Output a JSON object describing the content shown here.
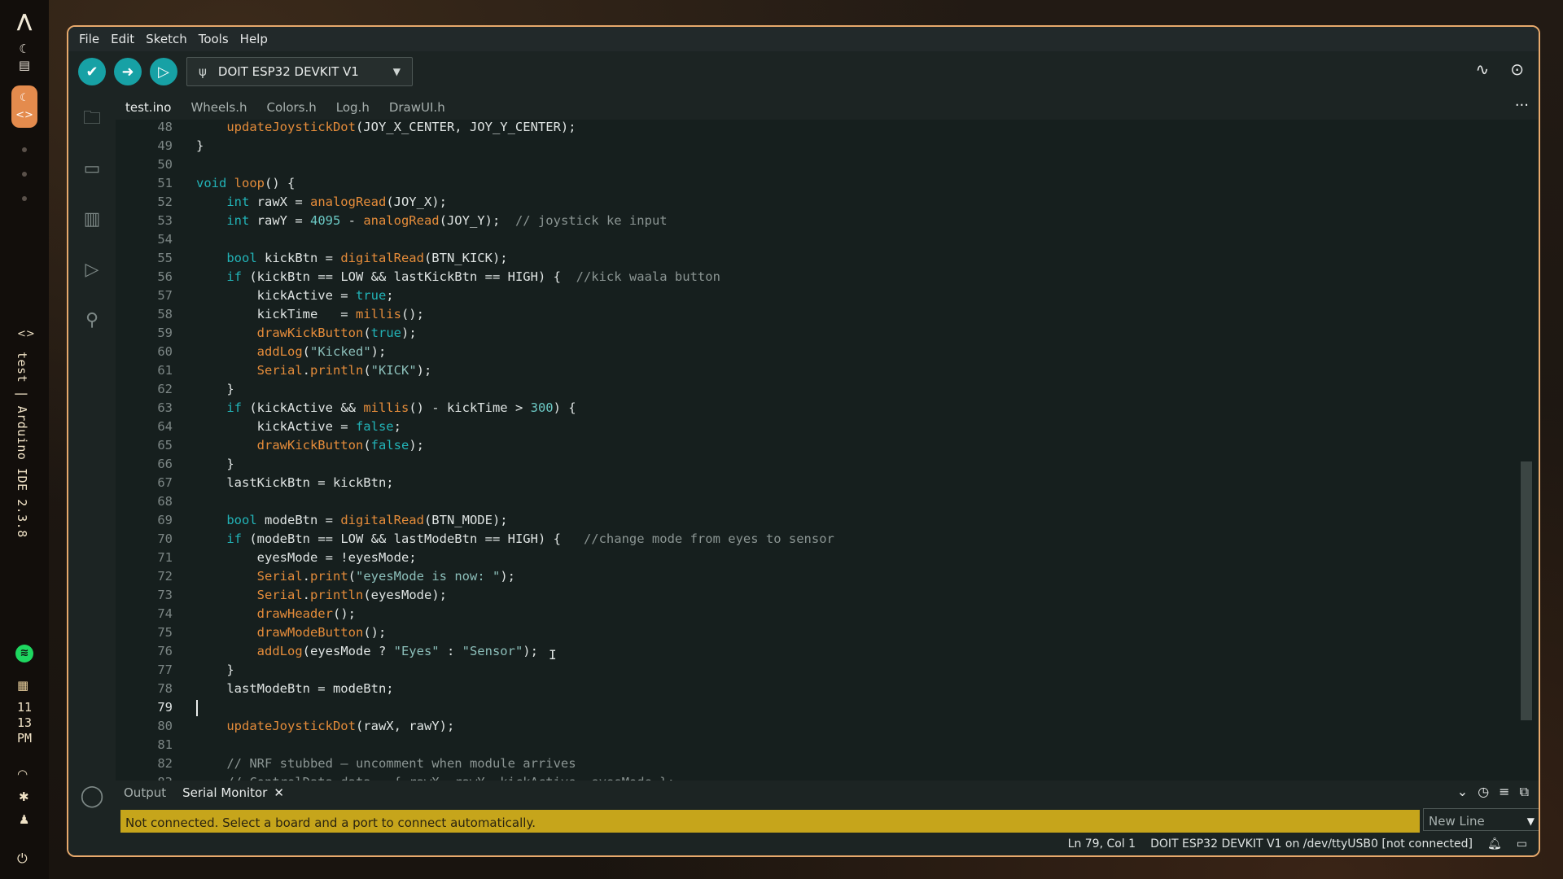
{
  "dock": {
    "window_label": "test | Arduino IDE 2.3.8",
    "clock_hour": "11",
    "clock_minute": "13",
    "clock_ampm": "PM"
  },
  "menu": [
    "File",
    "Edit",
    "Sketch",
    "Tools",
    "Help"
  ],
  "toolbar": {
    "board": "DOIT ESP32 DEVKIT V1"
  },
  "tabs": [
    "test.ino",
    "Wheels.h",
    "Colors.h",
    "Log.h",
    "DrawUI.h"
  ],
  "code_lines": [
    {
      "n": "48",
      "t": [
        [
          "    ",
          "plain"
        ],
        [
          "updateJoystickDot",
          "fn"
        ],
        [
          "(JOY_X_CENTER, JOY_Y_CENTER);",
          "plain"
        ]
      ]
    },
    {
      "n": "49",
      "t": [
        [
          "}",
          "plain"
        ]
      ]
    },
    {
      "n": "50",
      "t": []
    },
    {
      "n": "51",
      "t": [
        [
          "void",
          "kw"
        ],
        [
          " ",
          "plain"
        ],
        [
          "loop",
          "fn"
        ],
        [
          "() {",
          "plain"
        ]
      ]
    },
    {
      "n": "52",
      "t": [
        [
          "    ",
          "plain"
        ],
        [
          "int",
          "kw"
        ],
        [
          " rawX = ",
          "plain"
        ],
        [
          "analogRead",
          "fn"
        ],
        [
          "(JOY_X);",
          "plain"
        ]
      ]
    },
    {
      "n": "53",
      "t": [
        [
          "    ",
          "plain"
        ],
        [
          "int",
          "kw"
        ],
        [
          " rawY = ",
          "plain"
        ],
        [
          "4095",
          "num"
        ],
        [
          " - ",
          "plain"
        ],
        [
          "analogRead",
          "fn"
        ],
        [
          "(JOY_Y);  ",
          "plain"
        ],
        [
          "// joystick ke input",
          "com"
        ]
      ]
    },
    {
      "n": "54",
      "t": []
    },
    {
      "n": "55",
      "t": [
        [
          "    ",
          "plain"
        ],
        [
          "bool",
          "kw"
        ],
        [
          " kickBtn = ",
          "plain"
        ],
        [
          "digitalRead",
          "fn"
        ],
        [
          "(BTN_KICK);",
          "plain"
        ]
      ]
    },
    {
      "n": "56",
      "t": [
        [
          "    ",
          "plain"
        ],
        [
          "if",
          "kw"
        ],
        [
          " (kickBtn == LOW && lastKickBtn == HIGH) {  ",
          "plain"
        ],
        [
          "//kick waala button",
          "com"
        ]
      ]
    },
    {
      "n": "57",
      "t": [
        [
          "        kickActive = ",
          "plain"
        ],
        [
          "true",
          "kw"
        ],
        [
          ";",
          "plain"
        ]
      ]
    },
    {
      "n": "58",
      "t": [
        [
          "        kickTime   = ",
          "plain"
        ],
        [
          "millis",
          "fn"
        ],
        [
          "();",
          "plain"
        ]
      ]
    },
    {
      "n": "59",
      "t": [
        [
          "        ",
          "plain"
        ],
        [
          "drawKickButton",
          "fn"
        ],
        [
          "(",
          "plain"
        ],
        [
          "true",
          "kw"
        ],
        [
          ");",
          "plain"
        ]
      ]
    },
    {
      "n": "60",
      "t": [
        [
          "        ",
          "plain"
        ],
        [
          "addLog",
          "fn"
        ],
        [
          "(",
          "plain"
        ],
        [
          "\"Kicked\"",
          "str"
        ],
        [
          ");",
          "plain"
        ]
      ]
    },
    {
      "n": "61",
      "t": [
        [
          "        ",
          "plain"
        ],
        [
          "Serial",
          "fn"
        ],
        [
          ".",
          "plain"
        ],
        [
          "println",
          "fn"
        ],
        [
          "(",
          "plain"
        ],
        [
          "\"KICK\"",
          "str"
        ],
        [
          ");",
          "plain"
        ]
      ]
    },
    {
      "n": "62",
      "t": [
        [
          "    }",
          "plain"
        ]
      ]
    },
    {
      "n": "63",
      "t": [
        [
          "    ",
          "plain"
        ],
        [
          "if",
          "kw"
        ],
        [
          " (kickActive && ",
          "plain"
        ],
        [
          "millis",
          "fn"
        ],
        [
          "() - kickTime > ",
          "plain"
        ],
        [
          "300",
          "num"
        ],
        [
          ") {",
          "plain"
        ]
      ]
    },
    {
      "n": "64",
      "t": [
        [
          "        kickActive = ",
          "plain"
        ],
        [
          "false",
          "kw"
        ],
        [
          ";",
          "plain"
        ]
      ]
    },
    {
      "n": "65",
      "t": [
        [
          "        ",
          "plain"
        ],
        [
          "drawKickButton",
          "fn"
        ],
        [
          "(",
          "plain"
        ],
        [
          "false",
          "kw"
        ],
        [
          ");",
          "plain"
        ]
      ]
    },
    {
      "n": "66",
      "t": [
        [
          "    }",
          "plain"
        ]
      ]
    },
    {
      "n": "67",
      "t": [
        [
          "    lastKickBtn = kickBtn;",
          "plain"
        ]
      ]
    },
    {
      "n": "68",
      "t": []
    },
    {
      "n": "69",
      "t": [
        [
          "    ",
          "plain"
        ],
        [
          "bool",
          "kw"
        ],
        [
          " modeBtn = ",
          "plain"
        ],
        [
          "digitalRead",
          "fn"
        ],
        [
          "(BTN_MODE);",
          "plain"
        ]
      ]
    },
    {
      "n": "70",
      "t": [
        [
          "    ",
          "plain"
        ],
        [
          "if",
          "kw"
        ],
        [
          " (modeBtn == LOW && lastModeBtn == HIGH) {   ",
          "plain"
        ],
        [
          "//change mode from eyes to sensor",
          "com"
        ]
      ]
    },
    {
      "n": "71",
      "t": [
        [
          "        eyesMode = !eyesMode;",
          "plain"
        ]
      ]
    },
    {
      "n": "72",
      "t": [
        [
          "        ",
          "plain"
        ],
        [
          "Serial",
          "fn"
        ],
        [
          ".",
          "plain"
        ],
        [
          "print",
          "fn"
        ],
        [
          "(",
          "plain"
        ],
        [
          "\"eyesMode is now: \"",
          "str"
        ],
        [
          ");",
          "plain"
        ]
      ]
    },
    {
      "n": "73",
      "t": [
        [
          "        ",
          "plain"
        ],
        [
          "Serial",
          "fn"
        ],
        [
          ".",
          "plain"
        ],
        [
          "println",
          "fn"
        ],
        [
          "(eyesMode);",
          "plain"
        ]
      ]
    },
    {
      "n": "74",
      "t": [
        [
          "        ",
          "plain"
        ],
        [
          "drawHeader",
          "fn"
        ],
        [
          "();",
          "plain"
        ]
      ]
    },
    {
      "n": "75",
      "t": [
        [
          "        ",
          "plain"
        ],
        [
          "drawModeButton",
          "fn"
        ],
        [
          "();",
          "plain"
        ]
      ]
    },
    {
      "n": "76",
      "t": [
        [
          "        ",
          "plain"
        ],
        [
          "addLog",
          "fn"
        ],
        [
          "(eyesMode ? ",
          "plain"
        ],
        [
          "\"Eyes\"",
          "str"
        ],
        [
          " : ",
          "plain"
        ],
        [
          "\"Sensor\"",
          "str"
        ],
        [
          ");",
          "plain"
        ]
      ]
    },
    {
      "n": "77",
      "t": [
        [
          "    }",
          "plain"
        ]
      ]
    },
    {
      "n": "78",
      "t": [
        [
          "    lastModeBtn = modeBtn;",
          "plain"
        ]
      ]
    },
    {
      "n": "79",
      "t": []
    },
    {
      "n": "80",
      "t": [
        [
          "    ",
          "plain"
        ],
        [
          "updateJoystickDot",
          "fn"
        ],
        [
          "(rawX, rawY);",
          "plain"
        ]
      ]
    },
    {
      "n": "81",
      "t": []
    },
    {
      "n": "82",
      "t": [
        [
          "    ",
          "plain"
        ],
        [
          "// NRF stubbed — uncomment when module arrives",
          "com"
        ]
      ]
    },
    {
      "n": "83",
      "t": [
        [
          "    ",
          "plain"
        ],
        [
          "// ControlData data = { rawX, rawY, kickActive, eyesMode };",
          "com"
        ]
      ]
    }
  ],
  "current_line": "79",
  "panel": {
    "tab_output": "Output",
    "tab_serial": "Serial Monitor",
    "notice": "Not connected. Select a board and a port to connect automatically.",
    "line_ending": "New Line"
  },
  "status": {
    "position": "Ln 79, Col 1",
    "board": "DOIT ESP32 DEVKIT V1 on /dev/ttyUSB0 [not connected]"
  },
  "colors": {
    "accent": "#17a1a5",
    "window_border": "#e7a96c",
    "notice_bg": "#c6a51b",
    "keyword": "#22b3b7",
    "function": "#e58c3a"
  }
}
